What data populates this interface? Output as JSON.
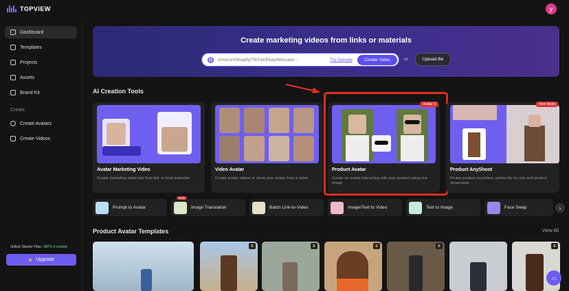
{
  "app": {
    "name": "TOPVIEW",
    "user_initial": "y"
  },
  "sidebar": {
    "items": [
      {
        "label": "Dashboard",
        "icon": "dashboard-icon",
        "active": true
      },
      {
        "label": "Templates",
        "icon": "templates-icon"
      },
      {
        "label": "Projects",
        "icon": "projects-icon"
      },
      {
        "label": "Assets",
        "icon": "folder-icon"
      },
      {
        "label": "Brand Kit",
        "icon": "brand-kit-icon"
      }
    ],
    "section_label": "Create",
    "create_items": [
      {
        "label": "Create Avatars",
        "icon": "avatar-icon"
      },
      {
        "label": "Create Videos",
        "icon": "video-icon"
      }
    ],
    "plan_label": "Gifted Starter Plan:",
    "plan_credits": "9875.4 credits",
    "upgrade_label": "Upgrade"
  },
  "hero": {
    "title": "Create marketing videos from links or materials",
    "search_placeholder": "Amazon/Shopify/TikTok/Ebay/Mercado...",
    "try_sample": "Try Sample",
    "create_button": "Create Video",
    "or": "or",
    "upload_button": "Upload file"
  },
  "tools": {
    "heading": "AI Creation Tools",
    "cards": [
      {
        "title": "Avatar Marketing Video",
        "desc": "Create marketing video ads from link or local materials",
        "badge": ""
      },
      {
        "title": "Video Avatar",
        "desc": "Create avatar videos or clone your avatar from a video",
        "badge": ""
      },
      {
        "title": "Product Avatar",
        "desc": "Create an avatar interacting with your product using one image",
        "badge": "Avatar 2"
      },
      {
        "title": "Product AnyShoot",
        "desc": "Fit any product anywhere, perfect for try-ons and product showcases",
        "badge": "New Mode"
      }
    ],
    "pills": [
      {
        "label": "Prompt to Avatar",
        "new": ""
      },
      {
        "label": "Image Translation",
        "new": "New"
      },
      {
        "label": "Batch Link-to-Video",
        "new": ""
      },
      {
        "label": "Image/Text to Video",
        "new": ""
      },
      {
        "label": "Text to Image",
        "new": ""
      },
      {
        "label": "Face Swap",
        "new": ""
      }
    ]
  },
  "templates": {
    "heading": "Product Avatar Templates",
    "view_all": "View All"
  },
  "colors": {
    "accent": "#6b5cf0",
    "highlight": "#e02c1f",
    "badge": "#e03434"
  }
}
